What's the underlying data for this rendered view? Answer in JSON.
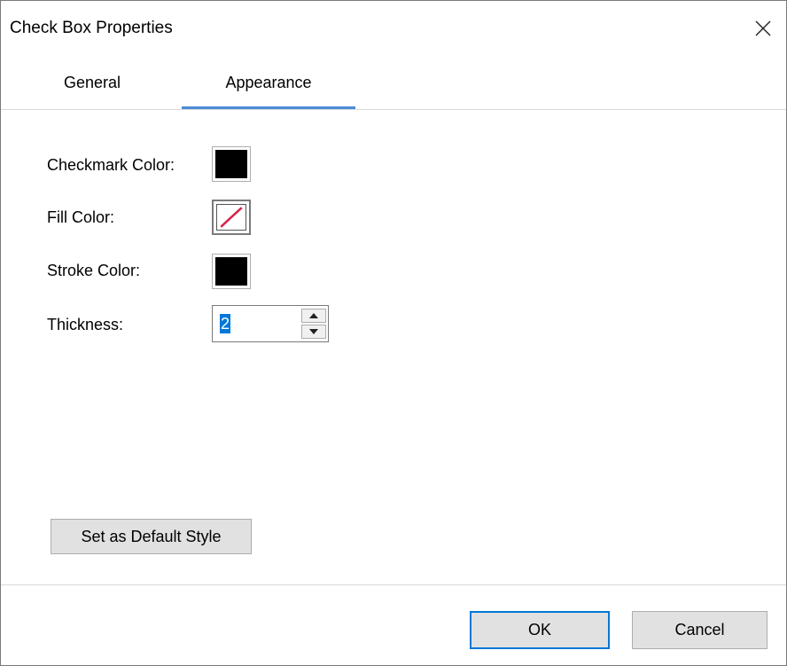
{
  "window": {
    "title": "Check Box Properties",
    "close_icon": "close-icon"
  },
  "tabs": [
    {
      "label": "General",
      "selected": false
    },
    {
      "label": "Appearance",
      "selected": true
    }
  ],
  "appearance": {
    "checkmark_color": {
      "label": "Checkmark Color:",
      "color": "#000000"
    },
    "fill_color": {
      "label": "Fill Color:",
      "color": "none",
      "icon": "no-color-icon"
    },
    "stroke_color": {
      "label": "Stroke Color:",
      "color": "#000000"
    },
    "thickness": {
      "label": "Thickness:",
      "value": "2"
    }
  },
  "buttons": {
    "set_default": "Set as Default Style",
    "ok": "OK",
    "cancel": "Cancel"
  },
  "colors": {
    "accent": "#4a8bd6",
    "selection": "#0078d7",
    "no_color_slash": "#d6244a"
  }
}
